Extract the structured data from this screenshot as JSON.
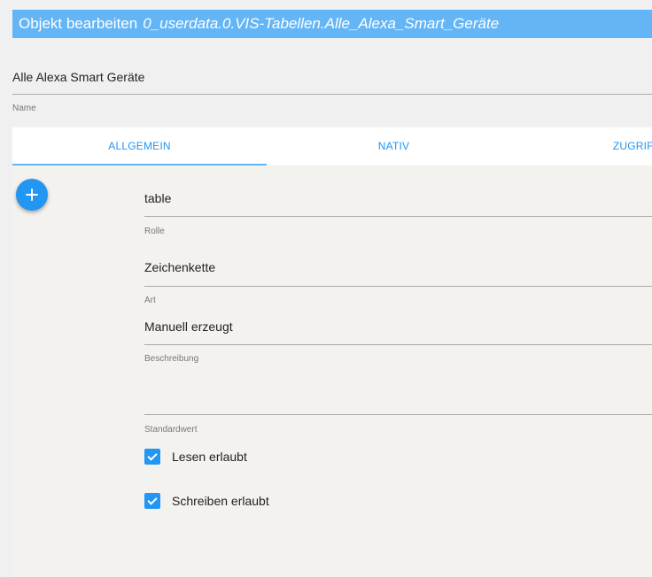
{
  "dialog": {
    "title_prefix": "Objekt bearbeiten",
    "object_id": "0_userdata.0.VIS-Tabellen.Alle_Alexa_Smart_Geräte"
  },
  "name_field": {
    "value": "Alle Alexa Smart Geräte",
    "label": "Name"
  },
  "tabs": [
    {
      "label": "ALLGEMEIN",
      "active": true
    },
    {
      "label": "NATIV",
      "active": false
    },
    {
      "label": "ZUGRIFFSKO",
      "active": false
    }
  ],
  "fields": {
    "rolle": {
      "value": "table",
      "label": "Rolle"
    },
    "art": {
      "value": "Zeichenkette",
      "label": "Art"
    },
    "beschreibung": {
      "value": "Manuell erzeugt",
      "label": "Beschreibung"
    },
    "standardwert": {
      "value": "",
      "label": "Standardwert"
    }
  },
  "checkboxes": {
    "lesen": {
      "label": "Lesen erlaubt",
      "checked": true
    },
    "schreiben": {
      "label": "Schreiben erlaubt",
      "checked": true
    }
  },
  "icons": {
    "add": "plus-icon",
    "check": "checkmark-icon"
  },
  "colors": {
    "accent": "#2196f3",
    "title_bar": "#64b5f6"
  }
}
